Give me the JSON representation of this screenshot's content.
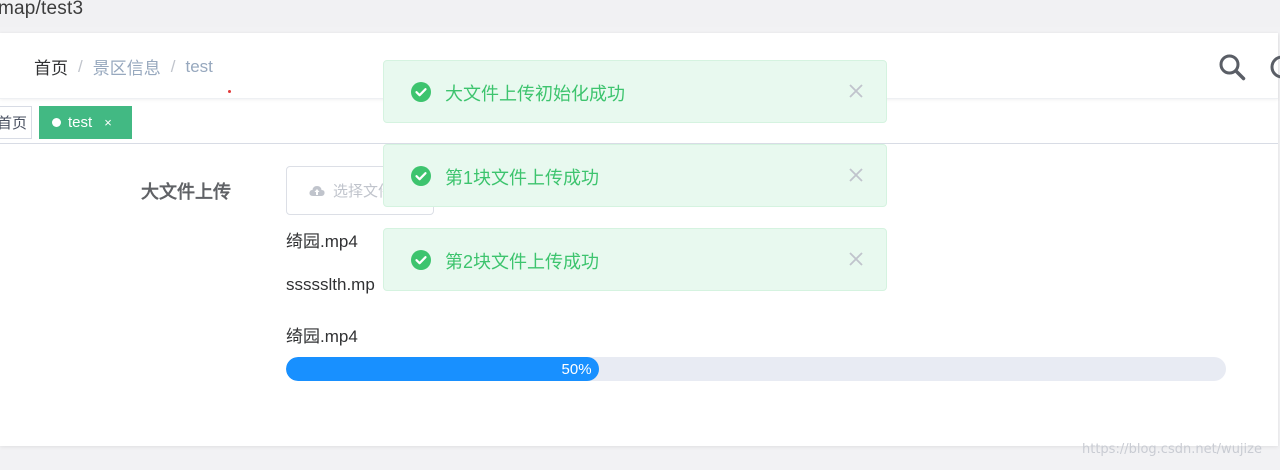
{
  "browser": {
    "url_fragment": "map/test3"
  },
  "breadcrumb": {
    "home": "首页",
    "section": "景区信息",
    "current": "test"
  },
  "tags": {
    "home": "首页",
    "active": "test",
    "close": "×"
  },
  "form": {
    "label": "大文件上传",
    "upload_button_label": "选择文件",
    "files": [
      {
        "name": "绮园.mp4"
      },
      {
        "name": "ssssslth.mp"
      },
      {
        "name": "绮园.mp4"
      }
    ],
    "progress": {
      "percent": 50,
      "label": "50%"
    }
  },
  "toasts": [
    {
      "message": "大文件上传初始化成功"
    },
    {
      "message": "第1块文件上传成功"
    },
    {
      "message": "第2块文件上传成功"
    }
  ],
  "watermark": "https://blog.csdn.net/wujize",
  "colors": {
    "accent": "#42b983",
    "progress": "#1890ff",
    "success_text": "#3dc46e",
    "success_bg": "#e8f9ef"
  }
}
